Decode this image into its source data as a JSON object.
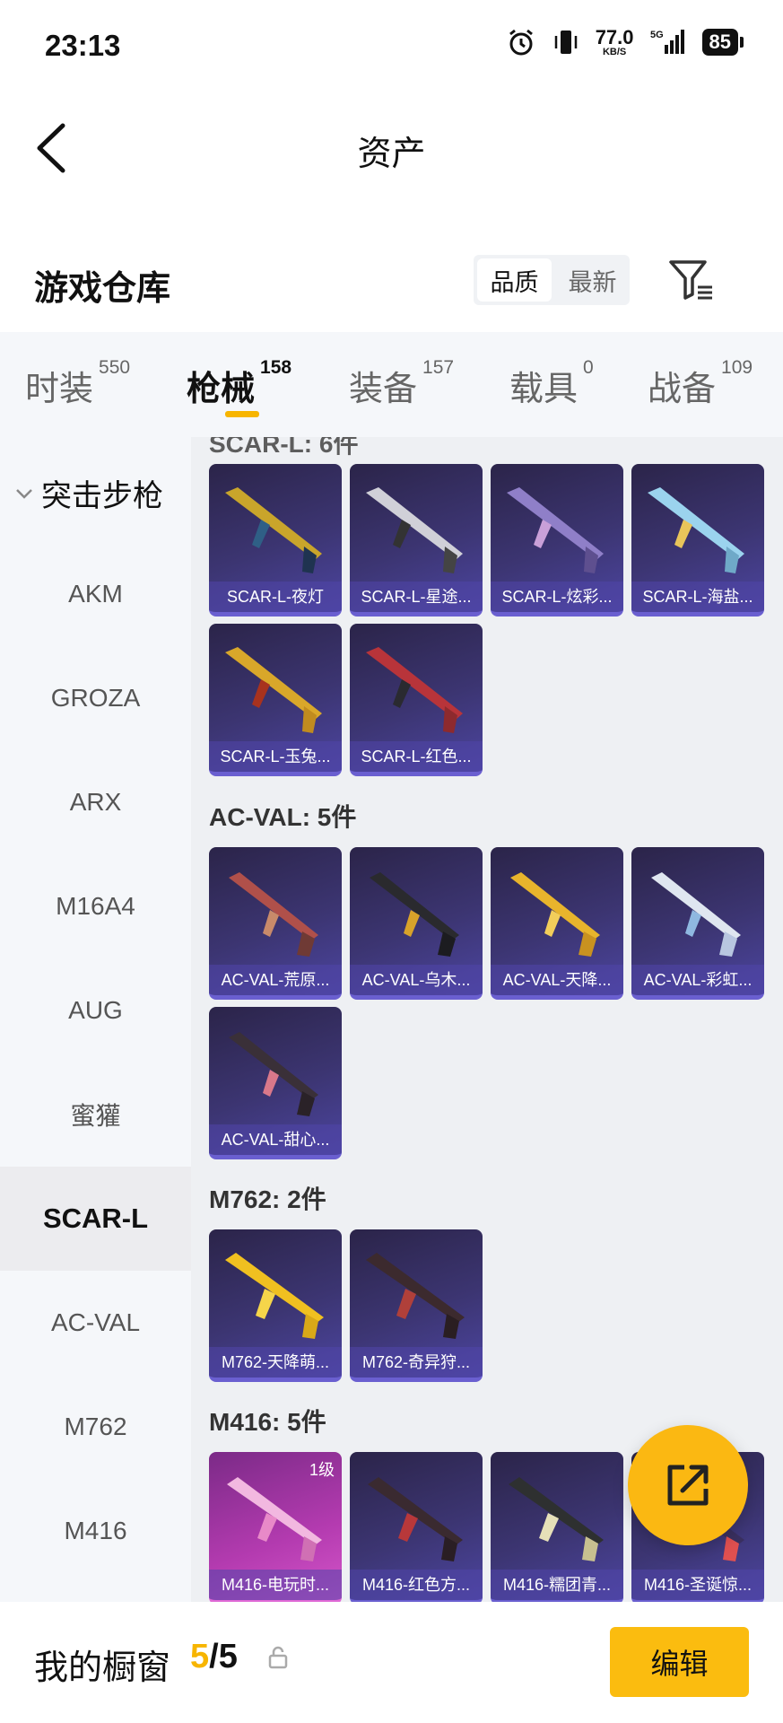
{
  "status_bar": {
    "time": "23:13",
    "net_speed": "77.0",
    "net_unit": "KB/S",
    "network": "5G",
    "battery": "85"
  },
  "header": {
    "title": "资产"
  },
  "warehouse": {
    "title": "游戏仓库",
    "sort_options": [
      "品质",
      "最新"
    ],
    "active_sort": "品质"
  },
  "tabs": [
    {
      "label": "时装",
      "count": "550"
    },
    {
      "label": "枪械",
      "count": "158",
      "active": true
    },
    {
      "label": "装备",
      "count": "157"
    },
    {
      "label": "载具",
      "count": "0"
    },
    {
      "label": "战备",
      "count": "109"
    }
  ],
  "sidebar": {
    "category": "突击步枪",
    "items": [
      "AKM",
      "GROZA",
      "ARX",
      "M16A4",
      "AUG",
      "蜜獾",
      "SCAR-L",
      "AC-VAL",
      "M762",
      "M416"
    ],
    "active": "SCAR-L"
  },
  "groups": {
    "scar_partial_header": "SCAR-L: 6件",
    "scar": [
      "SCAR-L-夜灯",
      "SCAR-L-星途...",
      "SCAR-L-炫彩...",
      "SCAR-L-海盐...",
      "SCAR-L-玉兔...",
      "SCAR-L-红色..."
    ],
    "acval_header": "AC-VAL: 5件",
    "acval": [
      "AC-VAL-荒原...",
      "AC-VAL-乌木...",
      "AC-VAL-天降...",
      "AC-VAL-彩虹...",
      "AC-VAL-甜心..."
    ],
    "m762_header": "M762: 2件",
    "m762": [
      "M762-天降萌...",
      "M762-奇异狩..."
    ],
    "m416_header": "M416: 5件",
    "m416": [
      "M416-电玩时...",
      "M416-红色方...",
      "M416-糯团青...",
      "M416-圣诞惊..."
    ],
    "m416_level": "1级"
  },
  "colors": {
    "accent": "#f7b500",
    "card_bg": "#3c3572",
    "card_pink": "#b43bb0"
  },
  "bottom": {
    "label": "我的橱窗",
    "current": "5",
    "sep": "/",
    "total": "5",
    "edit": "编辑"
  }
}
